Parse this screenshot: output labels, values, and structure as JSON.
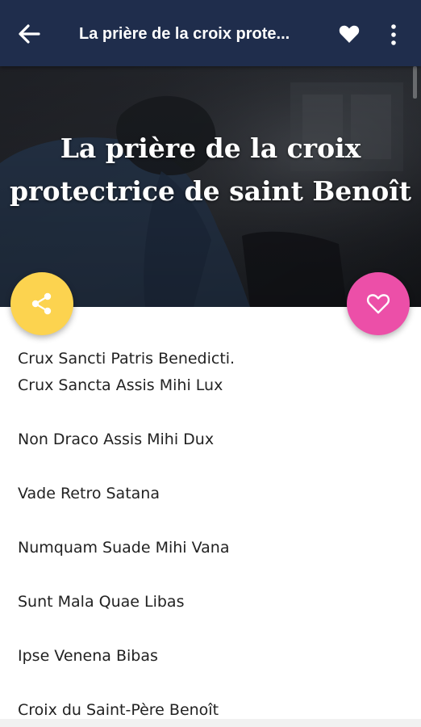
{
  "app_bar": {
    "title": "La prière de la croix prote...",
    "back_icon": "arrow-left-icon",
    "favorite_icon": "heart-icon",
    "menu_icon": "more-vertical-icon",
    "background_color": "#1f2d4c"
  },
  "hero": {
    "title": "La prière de la croix protectrice de saint Benoît"
  },
  "actions": {
    "share_icon": "share-icon",
    "share_color": "#fcd34f",
    "favorite_icon": "heart-outline-icon",
    "favorite_color": "#ec4fa8"
  },
  "prayer": {
    "paragraphs": [
      {
        "lines": [
          "Crux Sancti Patris Benedicti.",
          "Crux Sancta Assis Mihi Lux"
        ]
      },
      {
        "lines": [
          "Non Draco Assis Mihi Dux"
        ]
      },
      {
        "lines": [
          "Vade Retro Satana"
        ]
      },
      {
        "lines": [
          "Numquam Suade Mihi Vana"
        ]
      },
      {
        "lines": [
          "Sunt Mala Quae Libas"
        ]
      },
      {
        "lines": [
          "Ipse Venena Bibas"
        ]
      },
      {
        "lines": [
          "Croix du Saint-Père Benoît"
        ]
      }
    ]
  }
}
